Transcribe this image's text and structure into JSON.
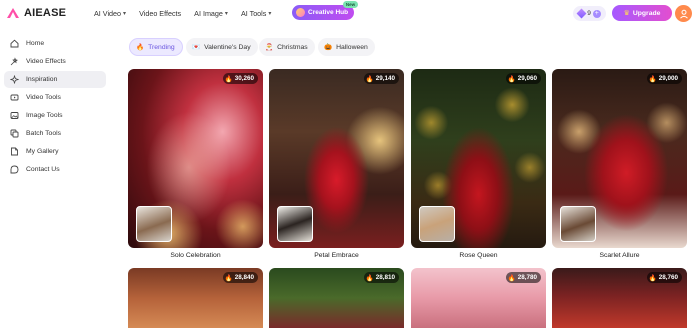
{
  "brand": {
    "name": "AIEASE"
  },
  "nav": {
    "items": [
      {
        "label": "AI Video",
        "dropdown": true
      },
      {
        "label": "Video Effects",
        "dropdown": false
      },
      {
        "label": "AI Image",
        "dropdown": true
      },
      {
        "label": "AI Tools",
        "dropdown": true
      }
    ],
    "creative_hub": {
      "label": "Creative Hub",
      "tag": "New"
    }
  },
  "account": {
    "credits": "9",
    "upgrade_label": "Upgrade"
  },
  "sidebar": {
    "items": [
      {
        "label": "Home",
        "icon": "home-icon"
      },
      {
        "label": "Video Effects",
        "icon": "video-effects-icon"
      },
      {
        "label": "Inspiration",
        "icon": "inspiration-icon",
        "active": true
      },
      {
        "label": "Video Tools",
        "icon": "video-tools-icon"
      },
      {
        "label": "Image Tools",
        "icon": "image-tools-icon"
      },
      {
        "label": "Batch Tools",
        "icon": "batch-tools-icon"
      },
      {
        "label": "My Gallery",
        "icon": "gallery-icon"
      },
      {
        "label": "Contact Us",
        "icon": "contact-icon"
      }
    ]
  },
  "categories": [
    {
      "label": "Trending",
      "emoji": "🔥",
      "active": true
    },
    {
      "label": "Valentine's Day",
      "emoji": "💌"
    },
    {
      "label": "Christmas",
      "emoji": "🎅"
    },
    {
      "label": "Halloween",
      "emoji": "🎃"
    }
  ],
  "cards": [
    {
      "title": "Solo Celebration",
      "count": "30,260"
    },
    {
      "title": "Petal Embrace",
      "count": "29,140"
    },
    {
      "title": "Rose Queen",
      "count": "29,060"
    },
    {
      "title": "Scarlet Allure",
      "count": "29,000"
    }
  ],
  "cards_row2": [
    {
      "count": "28,840"
    },
    {
      "count": "28,810"
    },
    {
      "count": "28,780"
    },
    {
      "count": "28,760"
    }
  ],
  "colors": {
    "accent": "#8b5cf6",
    "upgrade_start": "#a659ff",
    "upgrade_end": "#e34ecf",
    "badge_flame": "#ffb02e"
  }
}
